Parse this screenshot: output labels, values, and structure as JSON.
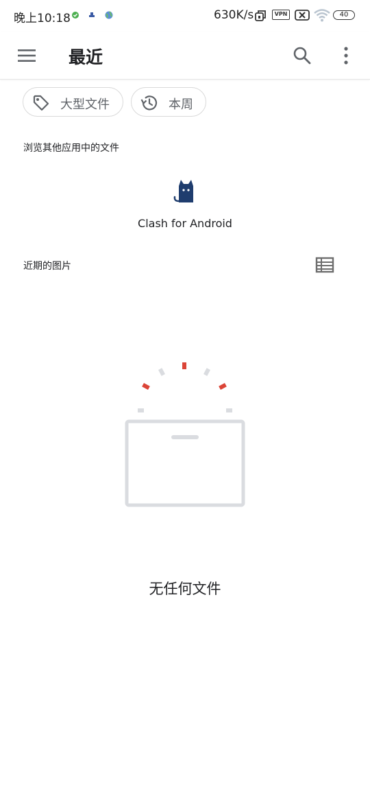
{
  "status_bar": {
    "time": "晚上10:18",
    "network_speed": "630K/s",
    "vpn_label": "VPN",
    "battery_level": "40"
  },
  "app_bar": {
    "title": "最近",
    "menu_icon": "menu-icon",
    "search_icon": "search-icon",
    "more_icon": "more-vert-icon"
  },
  "filters": [
    {
      "label": "大型文件",
      "icon": "tag-icon"
    },
    {
      "label": "本周",
      "icon": "history-icon"
    }
  ],
  "browse_section": {
    "label": "浏览其他应用中的文件",
    "apps": [
      {
        "name": "Clash for Android",
        "icon": "clash-cat-icon",
        "color": "#1f3d6e"
      }
    ]
  },
  "recent_images": {
    "label": "近期的图片",
    "view_toggle_icon": "list-view-icon"
  },
  "empty_state": {
    "message": "无任何文件",
    "accent_color": "#db4437",
    "neutral_color": "#dadce0"
  }
}
